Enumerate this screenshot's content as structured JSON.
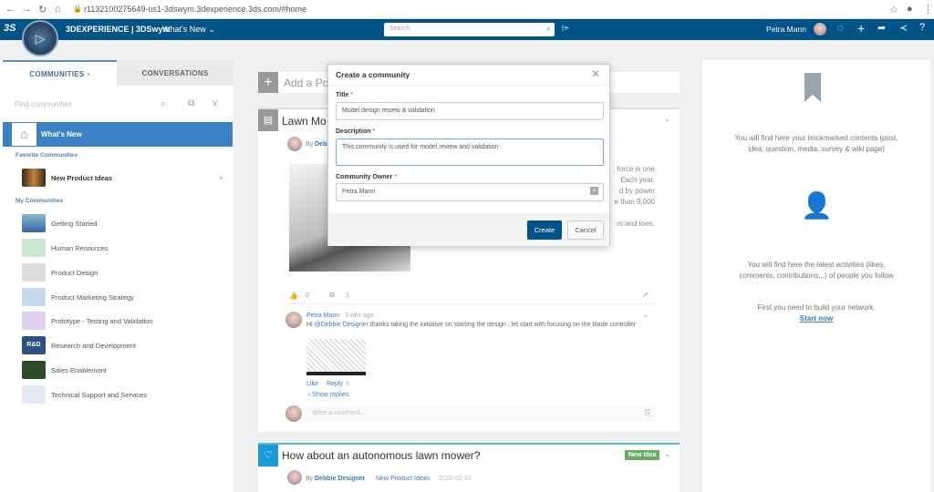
{
  "browser": {
    "url": "r1132100275649-us1-3dswym.3dexperience.3ds.com/#home"
  },
  "header": {
    "brand": "3DEXPERIENCE | 3DSwym",
    "app_menu": "What's New",
    "search_placeholder": "Search",
    "user": "Petra Mann"
  },
  "left": {
    "tabs": [
      "COMMUNITIES",
      "CONVERSATIONS"
    ],
    "find_placeholder": "Find communities",
    "whats_new": "What's New",
    "favorites_title": "Favorite Communities",
    "favorites": [
      "New Product Ideas"
    ],
    "my_title": "My Communities",
    "communities": [
      "Getting Started",
      "Human Resources",
      "Product Design",
      "Product Marketing Strategy",
      "Prototype - Testing and Validation",
      "Research and Development",
      "Sales Enablement",
      "Technical Support and Services"
    ]
  },
  "center": {
    "add_post": "Add a Post",
    "post1": {
      "title": "Lawn Mo",
      "by": "By",
      "author": "Debb",
      "body": [
        "force is one",
        "Each year,",
        "d by power",
        "e than 9,000",
        "",
        "rs and toes."
      ],
      "likes": "0",
      "shares": "1"
    },
    "comment": {
      "author": "Petra Mann",
      "time": "3 wks ago",
      "mention": "@Debbie Designer",
      "text": "thanks taking the initiative on starting the design , let start with focusing on the blade controller",
      "like": "Like",
      "reply": "Reply",
      "reply_count": "3",
      "show_replies": "Show replies",
      "write_placeholder": "Write a comment..."
    },
    "post2": {
      "title": "How about an autonomous lawn mower?",
      "badge": "New Idea",
      "by": "By",
      "author": "Debbie Designer",
      "community": "New Product Ideas",
      "date": "2020-02-10"
    }
  },
  "right": {
    "bookmarks_text": "You will find here your bookmarked contents (post, idea, question, media, survey & wiki page)",
    "activity_text": "You will find here the latest activities (likes, comments, contributions...) of people you follow",
    "network_text": "First you need to build your network.",
    "start_now": "Start now"
  },
  "modal": {
    "title": "Create a community",
    "title_label": "Title",
    "title_value": "Model design review & validation",
    "desc_label": "Description",
    "desc_value": "This community is used for model review and validation",
    "owner_label": "Community Owner",
    "owner_value": "Petra Mann",
    "create": "Create",
    "cancel": "Cancel",
    "required": "*"
  },
  "colors": {
    "header": "#005386",
    "accent": "#3a82c4",
    "badge": "#6aaa64"
  }
}
